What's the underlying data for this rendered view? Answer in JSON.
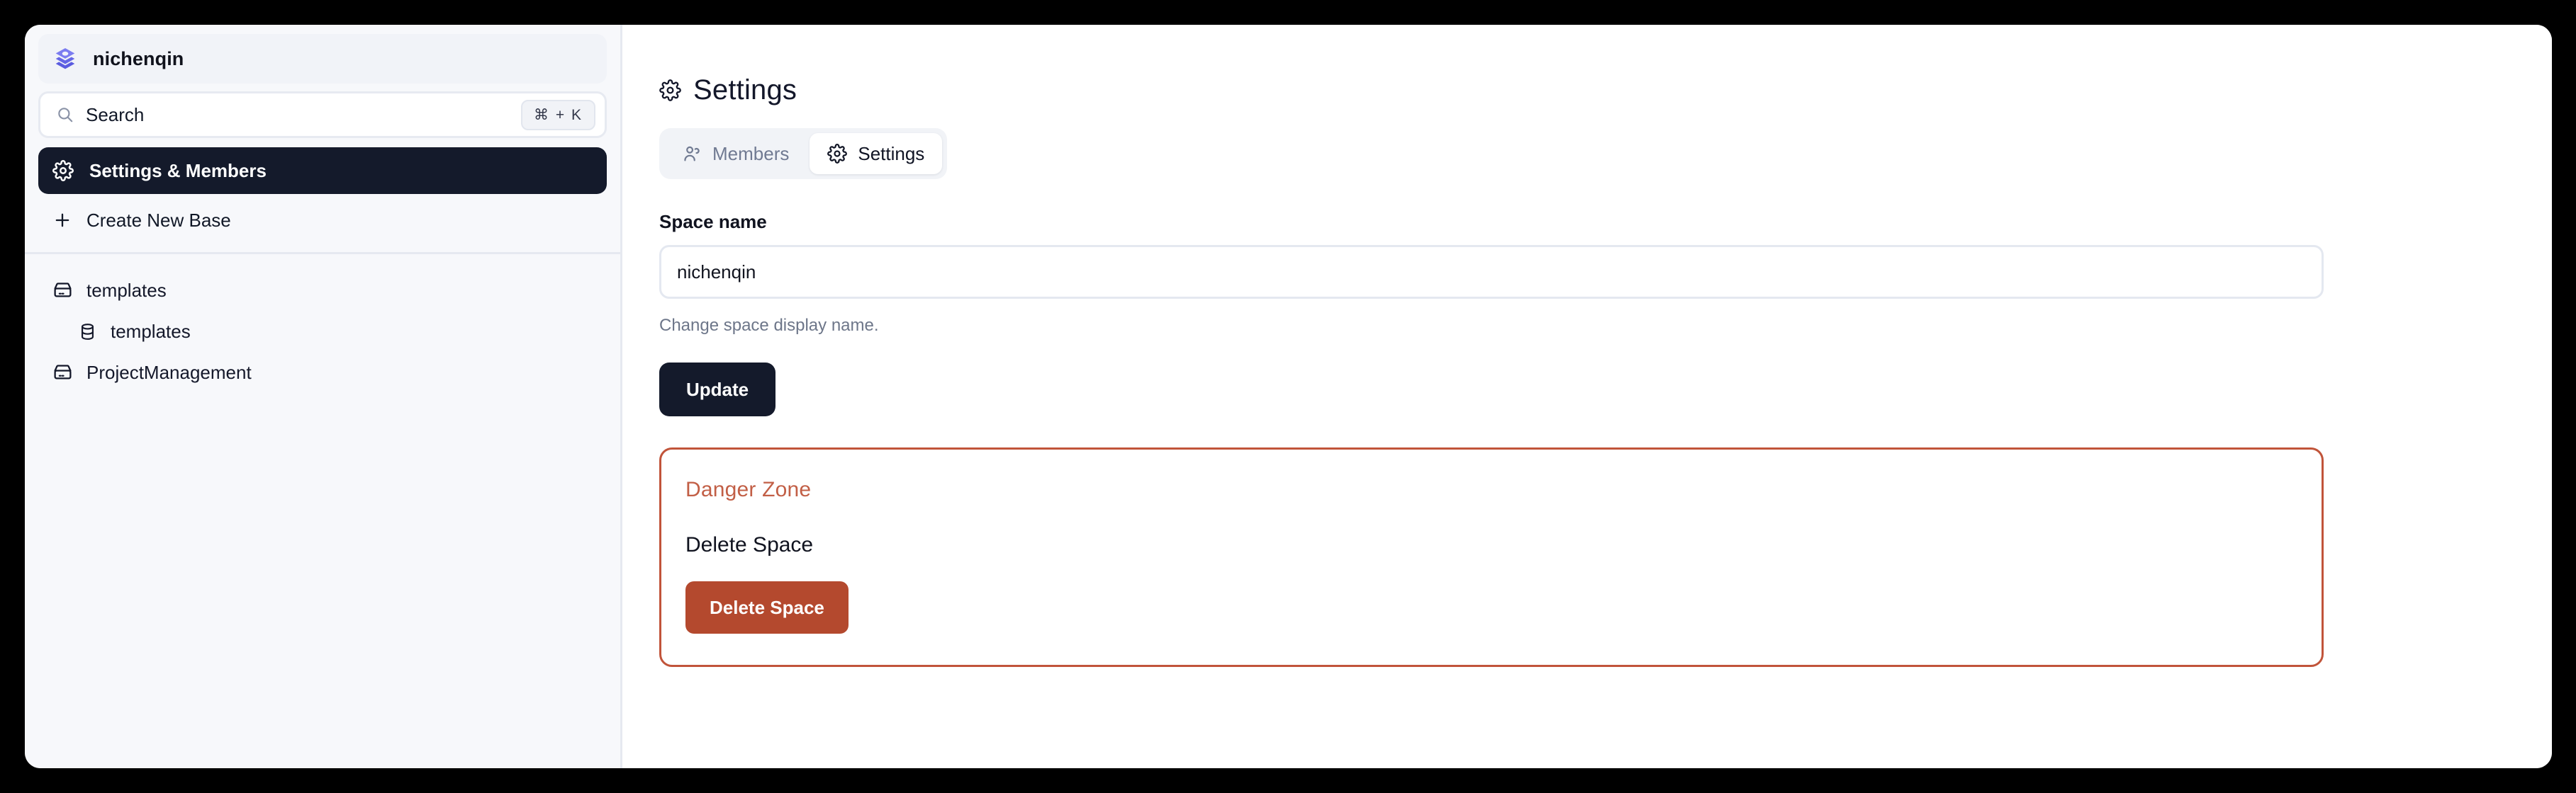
{
  "window": {
    "background": "#000000",
    "surface": "#ffffff"
  },
  "colors": {
    "sidebar_bg": "#f7f8fb",
    "active_nav_bg": "#141a2b",
    "accent_logo": "#6b6ce8",
    "danger_border": "#c1543a",
    "danger_title": "#c25f46",
    "danger_button": "#b4492e",
    "primary_button": "#141a2b"
  },
  "sidebar": {
    "space": {
      "name": "nichenqin",
      "logo_icon": "layers-stack-icon"
    },
    "search": {
      "placeholder": "Search",
      "icon": "search-icon",
      "shortcut": "⌘ + K"
    },
    "nav": [
      {
        "label": "Settings & Members",
        "icon": "gear-icon",
        "active": true
      },
      {
        "label": "Create New Base",
        "icon": "plus-icon",
        "active": false
      }
    ],
    "tree": [
      {
        "label": "templates",
        "icon": "box-icon",
        "level": 0
      },
      {
        "label": "templates",
        "icon": "database-icon",
        "level": 1
      },
      {
        "label": "ProjectManagement",
        "icon": "box-icon",
        "level": 0
      }
    ]
  },
  "main": {
    "page_title": "Settings",
    "page_title_icon": "gear-icon",
    "tabs": [
      {
        "label": "Members",
        "icon": "members-icon",
        "active": false
      },
      {
        "label": "Settings",
        "icon": "gear-icon",
        "active": true
      }
    ],
    "space_name_field": {
      "label": "Space name",
      "value": "nichenqin",
      "placeholder": "Space name",
      "help": "Change space display name."
    },
    "update_button": "Update",
    "danger_zone": {
      "title": "Danger Zone",
      "subtitle": "Delete Space",
      "button": "Delete Space"
    }
  }
}
